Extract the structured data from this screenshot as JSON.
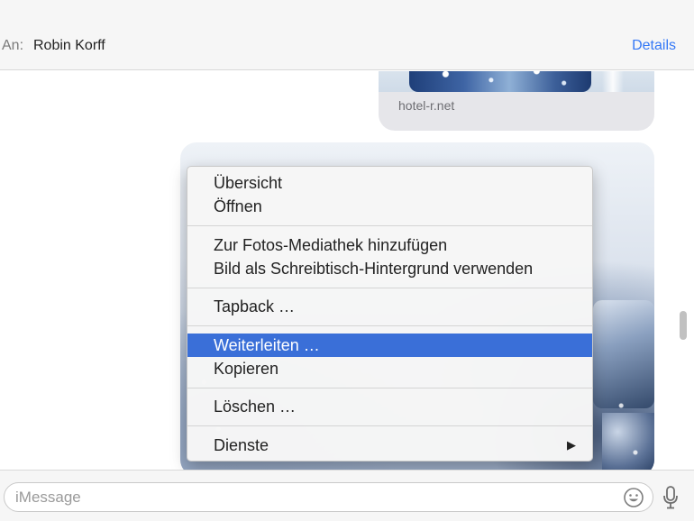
{
  "header": {
    "to_prefix": "An:",
    "recipient": "Robin Korff",
    "details_label": "Details"
  },
  "conversation": {
    "link_preview": {
      "domain": "hotel-r.net"
    }
  },
  "context_menu": {
    "groups": [
      [
        "Übersicht",
        "Öffnen"
      ],
      [
        "Zur Fotos-Mediathek hinzufügen",
        "Bild als Schreibtisch-Hintergrund verwenden"
      ],
      [
        "Tapback …"
      ],
      [
        "Weiterleiten …",
        "Kopieren"
      ],
      [
        "Löschen …"
      ],
      [
        "Dienste"
      ]
    ],
    "highlighted_item": "Weiterleiten …",
    "submenu_item": "Dienste"
  },
  "footer": {
    "input_placeholder": "iMessage",
    "input_value": "",
    "emoji_icon": "emoji-icon",
    "mic_icon": "microphone-icon"
  },
  "colors": {
    "accent": "#3478f6",
    "menu_highlight": "#3a6fd8"
  }
}
